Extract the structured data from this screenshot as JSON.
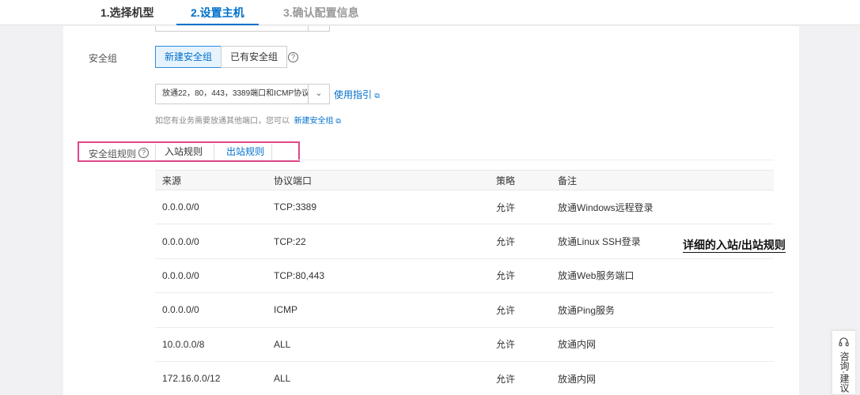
{
  "steps": [
    {
      "label": "1.选择机型",
      "state": "done"
    },
    {
      "label": "2.设置主机",
      "state": "active"
    },
    {
      "label": "3.确认配置信息",
      "state": "todo"
    }
  ],
  "security_group": {
    "label": "安全组",
    "options": [
      "新建安全组",
      "已有安全组"
    ],
    "selected_option": "新建安全组",
    "select_value": "放通22，80，443，3389端口和ICMP协议",
    "guide_link": "使用指引",
    "hint_text": "如您有业务需要放通其他端口，您可以",
    "hint_link": "新建安全组"
  },
  "rules": {
    "label": "安全组规则",
    "tabs": [
      "入站规则",
      "出站规则"
    ],
    "active_tab": "出站规则",
    "columns": [
      "来源",
      "协议端口",
      "策略",
      "备注"
    ],
    "rows": [
      [
        "0.0.0.0/0",
        "TCP:3389",
        "允许",
        "放通Windows远程登录"
      ],
      [
        "0.0.0.0/0",
        "TCP:22",
        "允许",
        "放通Linux SSH登录"
      ],
      [
        "0.0.0.0/0",
        "TCP:80,443",
        "允许",
        "放通Web服务端口"
      ],
      [
        "0.0.0.0/0",
        "ICMP",
        "允许",
        "放通Ping服务"
      ],
      [
        "10.0.0.0/8",
        "ALL",
        "允许",
        "放通内网"
      ],
      [
        "172.16.0.0/12",
        "ALL",
        "允许",
        "放通内网"
      ]
    ]
  },
  "annotation": "详细的入站/出站规则",
  "floating": {
    "label": "咨询·建议"
  },
  "colors": {
    "accent": "#0070cc",
    "highlight_border": "#e0468a",
    "selected_bg": "#e6f3fd"
  }
}
